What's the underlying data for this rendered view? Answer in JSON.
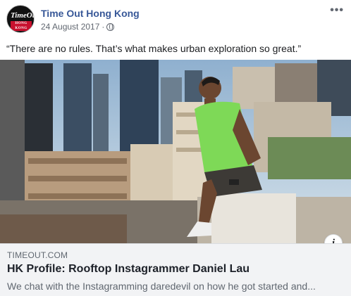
{
  "post": {
    "page_name": "Time Out Hong Kong",
    "logo_text": "TimeOut",
    "logo_subtext": "HONG KONG",
    "date": "24 August 2017",
    "separator": "·",
    "privacy_icon": "globe-icon",
    "more_label": "•••",
    "caption": "“There are no rules. That’s what makes urban exploration so great.”"
  },
  "link_preview": {
    "domain": "TIMEOUT.COM",
    "title": "HK Profile: Rooftop Instagrammer Daniel Lau",
    "description": "We chat with the Instagramming daredevil on how he got started and...",
    "info_label": "i"
  },
  "colors": {
    "page_name": "#385898",
    "sky": "#9db8d2",
    "shirt": "#7ed957",
    "footer_bg": "#f2f3f5"
  }
}
